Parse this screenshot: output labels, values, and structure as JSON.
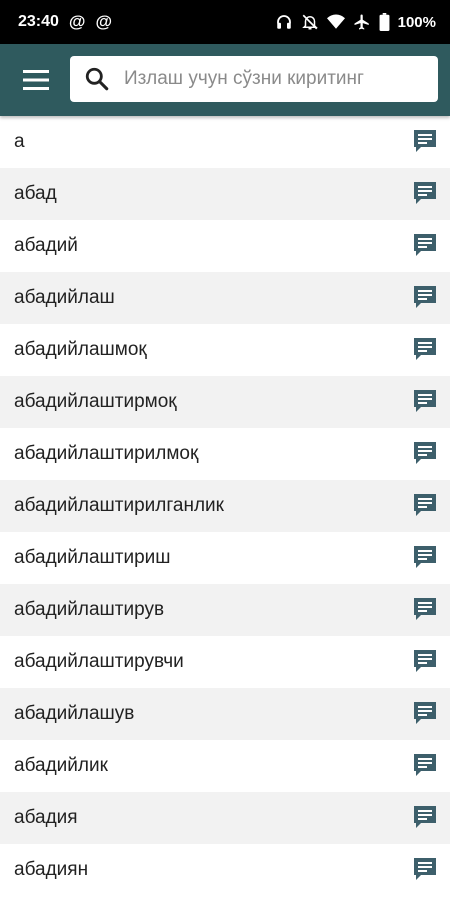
{
  "status_bar": {
    "time": "23:40",
    "notif_1": "@",
    "notif_2": "@",
    "battery": "100%"
  },
  "toolbar": {
    "menu_icon": "hamburger-menu-icon",
    "search_placeholder": "Излаш учун сўзни киритинг",
    "search_value": ""
  },
  "colors": {
    "toolbar_bg": "#2f5a5e",
    "icon_color": "#3d5f6b",
    "alt_row_bg": "#f2f2f2"
  },
  "words": [
    {
      "text": "а"
    },
    {
      "text": "абад"
    },
    {
      "text": "абадий"
    },
    {
      "text": "абадийлаш"
    },
    {
      "text": "абадийлашмоқ"
    },
    {
      "text": "абадийлаштирмоқ"
    },
    {
      "text": "абадийлаштирилмоқ"
    },
    {
      "text": "абадийлаштирилганлик"
    },
    {
      "text": "абадийлаштириш"
    },
    {
      "text": "абадийлаштирув"
    },
    {
      "text": "абадийлаштирувчи"
    },
    {
      "text": "абадийлашув"
    },
    {
      "text": "абадийлик"
    },
    {
      "text": "абадия"
    },
    {
      "text": "абадиян"
    }
  ]
}
